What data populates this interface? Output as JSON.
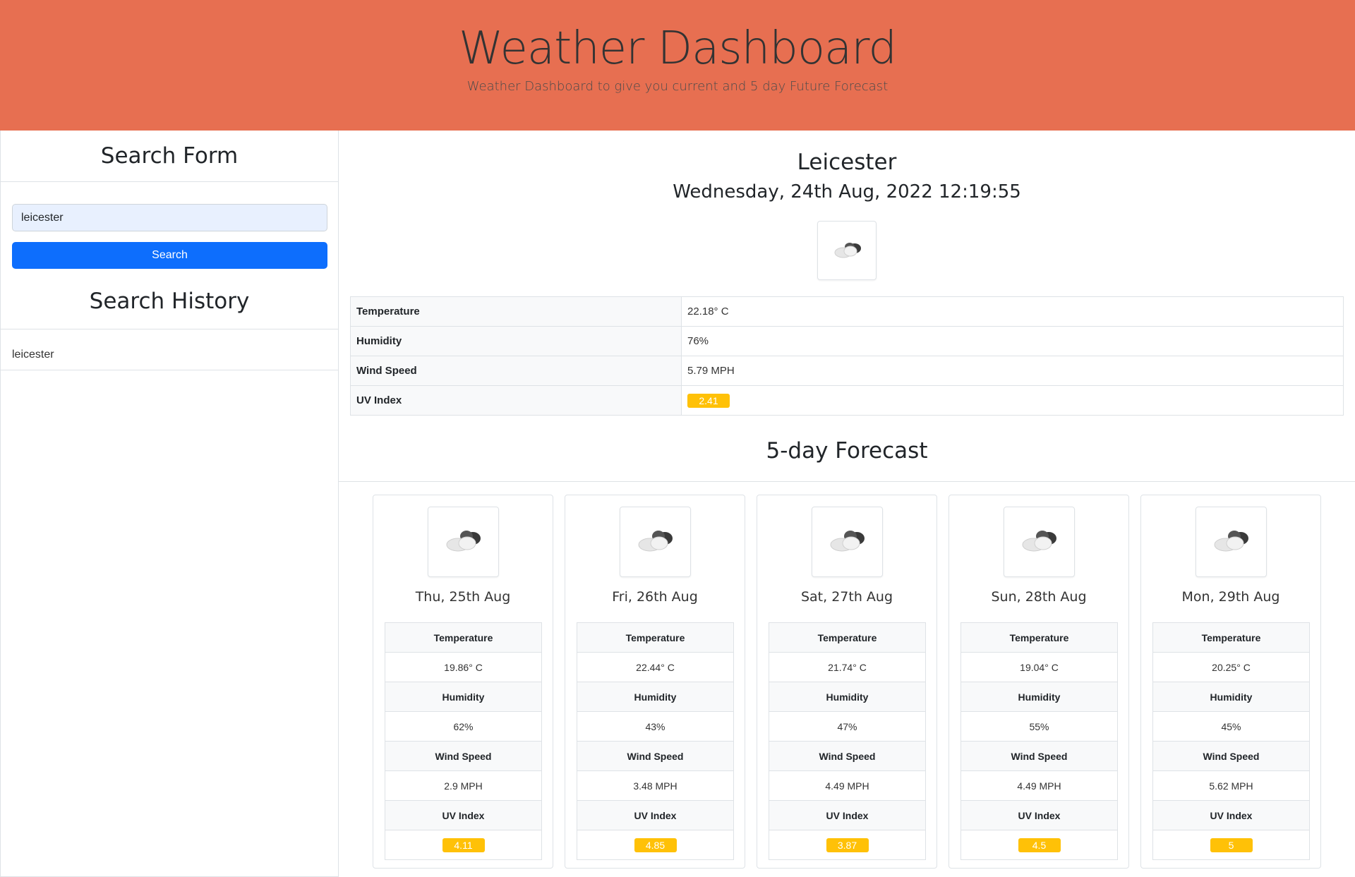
{
  "header": {
    "title": "Weather Dashboard",
    "subtitle": "Weather Dashboard to give you current and 5 day Future Forecast"
  },
  "sidebar": {
    "search_title": "Search Form",
    "search_value": "leicester",
    "search_button": "Search",
    "history_title": "Search History",
    "history": [
      "leicester"
    ]
  },
  "current": {
    "city": "Leicester",
    "datetime": "Wednesday, 24th Aug, 2022 12:19:55",
    "icon": "cloud-icon",
    "rows": [
      {
        "label": "Temperature",
        "value": "22.18° C"
      },
      {
        "label": "Humidity",
        "value": "76%"
      },
      {
        "label": "Wind Speed",
        "value": "5.79 MPH"
      },
      {
        "label": "UV Index",
        "value": "2.41"
      }
    ]
  },
  "forecast": {
    "title": "5-day Forecast",
    "labels": {
      "temperature": "Temperature",
      "humidity": "Humidity",
      "wind": "Wind Speed",
      "uv": "UV Index"
    },
    "days": [
      {
        "date": "Thu, 25th Aug",
        "temperature": "19.86° C",
        "humidity": "62%",
        "wind": "2.9 MPH",
        "uv": "4.11"
      },
      {
        "date": "Fri, 26th Aug",
        "temperature": "22.44° C",
        "humidity": "43%",
        "wind": "3.48 MPH",
        "uv": "4.85"
      },
      {
        "date": "Sat, 27th Aug",
        "temperature": "21.74° C",
        "humidity": "47%",
        "wind": "4.49 MPH",
        "uv": "3.87"
      },
      {
        "date": "Sun, 28th Aug",
        "temperature": "19.04° C",
        "humidity": "55%",
        "wind": "4.49 MPH",
        "uv": "4.5"
      },
      {
        "date": "Mon, 29th Aug",
        "temperature": "20.25° C",
        "humidity": "45%",
        "wind": "5.62 MPH",
        "uv": "5"
      }
    ]
  },
  "colors": {
    "header_bg": "#e76f51",
    "button": "#0d6efd",
    "uv_badge": "#ffc107"
  }
}
